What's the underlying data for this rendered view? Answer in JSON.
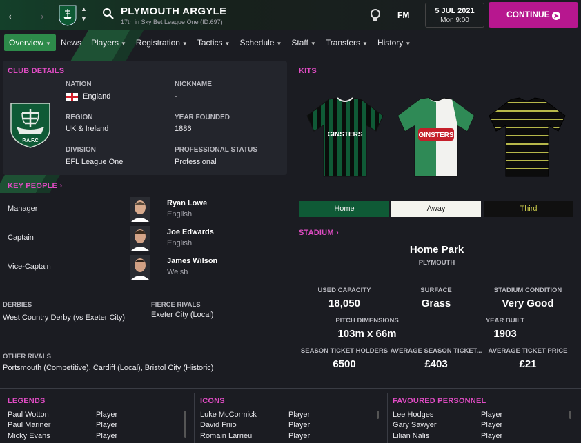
{
  "header": {
    "club_name": "PLYMOUTH ARGYLE",
    "club_subtitle": "17th in Sky Bet League One (ID:697)",
    "fm_label": "FM",
    "date": "5 JUL 2021",
    "day_time": "Mon 9:00",
    "continue_label": "CONTINUE"
  },
  "tabs": [
    {
      "label": "Overview",
      "active": true
    },
    {
      "label": "News",
      "dropdown": false
    },
    {
      "label": "Players",
      "dropdown": true
    },
    {
      "label": "Registration",
      "dropdown": true
    },
    {
      "label": "Tactics",
      "dropdown": true
    },
    {
      "label": "Schedule",
      "dropdown": true
    },
    {
      "label": "Staff",
      "dropdown": true
    },
    {
      "label": "Transfers",
      "dropdown": true
    },
    {
      "label": "History",
      "dropdown": true
    }
  ],
  "club_details": {
    "title": "CLUB DETAILS",
    "nation_label": "NATION",
    "nation": "England",
    "nickname_label": "NICKNAME",
    "nickname": "-",
    "region_label": "REGION",
    "region": "UK & Ireland",
    "year_founded_label": "YEAR FOUNDED",
    "year_founded": "1886",
    "division_label": "DIVISION",
    "division": "EFL League One",
    "pro_status_label": "PROFESSIONAL STATUS",
    "pro_status": "Professional",
    "badge_text": "P.A.F.C"
  },
  "key_people": {
    "title": "KEY PEOPLE",
    "people": [
      {
        "role": "Manager",
        "name": "Ryan Lowe",
        "nationality": "English"
      },
      {
        "role": "Captain",
        "name": "Joe Edwards",
        "nationality": "English"
      },
      {
        "role": "Vice-Captain",
        "name": "James Wilson",
        "nationality": "Welsh"
      }
    ]
  },
  "rivals": {
    "derbies_label": "DERBIES",
    "derbies": "West Country Derby (vs Exeter City)",
    "fierce_label": "FIERCE RIVALS",
    "fierce": "Exeter City (Local)",
    "other_label": "OTHER RIVALS",
    "other": "Portsmouth (Competitive), Cardiff (Local), Bristol City (Historic)"
  },
  "kits": {
    "title": "KITS",
    "buttons": [
      "Home",
      "Away",
      "Third"
    ],
    "sponsor": "GINSTERS"
  },
  "stadium": {
    "title": "STADIUM",
    "name": "Home Park",
    "city": "PLYMOUTH",
    "used_capacity_label": "USED CAPACITY",
    "used_capacity": "18,050",
    "surface_label": "SURFACE",
    "surface": "Grass",
    "condition_label": "STADIUM CONDITION",
    "condition": "Very Good",
    "pitch_label": "PITCH DIMENSIONS",
    "pitch": "103m x 66m",
    "year_built_label": "YEAR BUILT",
    "year_built": "1903",
    "season_holders_label": "SEASON TICKET HOLDERS",
    "season_holders": "6500",
    "avg_season_label": "AVERAGE SEASON TICKET...",
    "avg_season": "£403",
    "avg_ticket_label": "AVERAGE TICKET PRICE",
    "avg_ticket": "£21"
  },
  "legends": {
    "title": "LEGENDS",
    "rows": [
      {
        "name": "Paul Wotton",
        "role": "Player"
      },
      {
        "name": "Paul Mariner",
        "role": "Player"
      },
      {
        "name": "Micky Evans",
        "role": "Player"
      }
    ]
  },
  "icons_list": {
    "title": "ICONS",
    "rows": [
      {
        "name": "Luke McCormick",
        "role": "Player"
      },
      {
        "name": "David Friio",
        "role": "Player"
      },
      {
        "name": "Romain Larrieu",
        "role": "Player"
      }
    ]
  },
  "favoured": {
    "title": "FAVOURED PERSONNEL",
    "rows": [
      {
        "name": "Lee Hodges",
        "role": "Player"
      },
      {
        "name": "Gary Sawyer",
        "role": "Player"
      },
      {
        "name": "Lilian Nalis",
        "role": "Player"
      }
    ]
  },
  "colors": {
    "accent_pink": "#e04cc4",
    "continue_bg": "#b7178f",
    "tab_active": "#2d8a4a",
    "home_kit_btn": "#0f5a36",
    "away_kit_btn": "#f4f4ee",
    "third_kit_btn": "#101010",
    "third_kit_text": "#c8c84a"
  }
}
